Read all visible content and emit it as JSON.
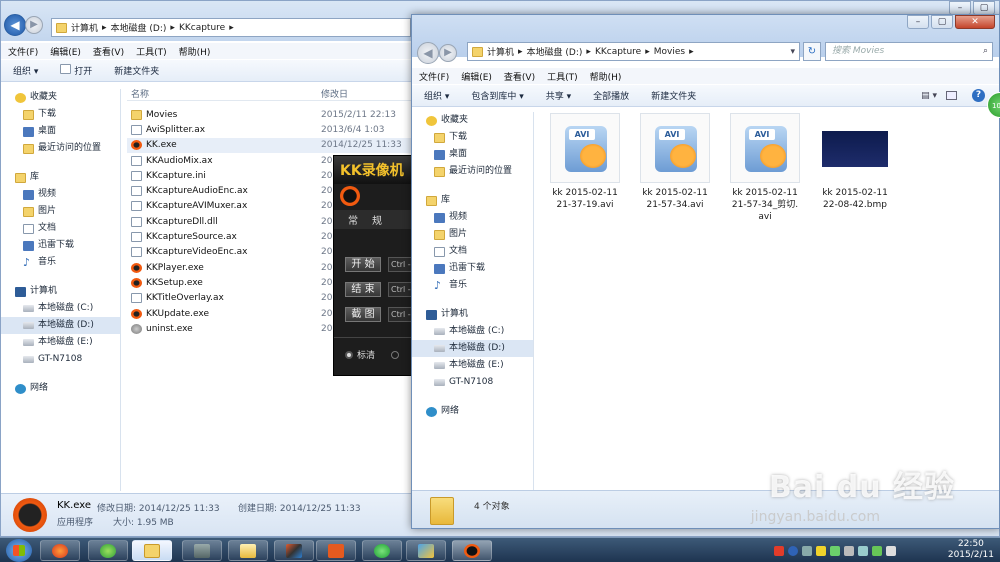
{
  "windowA": {
    "address": [
      "计算机",
      "本地磁盘 (D:)",
      "KKcapture"
    ],
    "menu": [
      "文件(F)",
      "编辑(E)",
      "查看(V)",
      "工具(T)",
      "帮助(H)"
    ],
    "toolbar": {
      "organize": "组织 ▾",
      "open": "打开",
      "new_folder": "新建文件夹"
    },
    "columns": {
      "name": "名称",
      "modified": "修改日"
    },
    "nav": {
      "favorites": "收藏夹",
      "fav_items": [
        "下载",
        "桌面",
        "最近访问的位置"
      ],
      "libraries": "库",
      "lib_items": [
        "视频",
        "图片",
        "文档",
        "迅雷下载",
        "音乐"
      ],
      "computer": "计算机",
      "drives": [
        "本地磁盘 (C:)",
        "本地磁盘 (D:)",
        "本地磁盘 (E:)",
        "GT-N7108"
      ],
      "network": "网络"
    },
    "files": [
      {
        "name": "Movies",
        "date": "2015/2/11 22:13",
        "icon": "folder-icon"
      },
      {
        "name": "AviSplitter.ax",
        "date": "2013/6/4 1:03",
        "icon": "doc-icon"
      },
      {
        "name": "KK.exe",
        "date": "2014/12/25 11:33",
        "icon": "kk-icon"
      },
      {
        "name": "KKAudioMix.ax",
        "date": "201",
        "icon": "doc-icon"
      },
      {
        "name": "KKcapture.ini",
        "date": "201",
        "icon": "doc-icon"
      },
      {
        "name": "KKcaptureAudioEnc.ax",
        "date": "201",
        "icon": "doc-icon"
      },
      {
        "name": "KKcaptureAVIMuxer.ax",
        "date": "201",
        "icon": "doc-icon"
      },
      {
        "name": "KKcaptureDll.dll",
        "date": "201",
        "icon": "doc-icon"
      },
      {
        "name": "KKcaptureSource.ax",
        "date": "201",
        "icon": "doc-icon"
      },
      {
        "name": "KKcaptureVideoEnc.ax",
        "date": "201",
        "icon": "doc-icon"
      },
      {
        "name": "KKPlayer.exe",
        "date": "201",
        "icon": "kk-icon"
      },
      {
        "name": "KKSetup.exe",
        "date": "201",
        "icon": "kk-icon"
      },
      {
        "name": "KKTitleOverlay.ax",
        "date": "201",
        "icon": "doc-icon"
      },
      {
        "name": "KKUpdate.exe",
        "date": "201",
        "icon": "kk-icon"
      },
      {
        "name": "uninst.exe",
        "date": "201",
        "icon": "uninst-icon"
      }
    ],
    "details": {
      "name": "KK.exe",
      "modified_label": "修改日期: 2014/12/25 11:33",
      "created_label": "创建日期: 2014/12/25 11:33",
      "type": "应用程序",
      "size": "大小: 1.95 MB"
    }
  },
  "kk_app": {
    "title": "KK录像机",
    "tabs": [
      "常",
      "规"
    ],
    "buttons": [
      "开 始",
      "结 束",
      "截 图"
    ],
    "keys": [
      "Ctrl -",
      "Ctrl -",
      "Ctrl -"
    ],
    "radio": "标清"
  },
  "windowB": {
    "address": [
      "计算机",
      "本地磁盘 (D:)",
      "KKcapture",
      "Movies"
    ],
    "search_placeholder": "搜索 Movies",
    "menu": [
      "文件(F)",
      "编辑(E)",
      "查看(V)",
      "工具(T)",
      "帮助(H)"
    ],
    "toolbar": [
      "组织 ▾",
      "包含到库中 ▾",
      "共享 ▾",
      "全部播放",
      "新建文件夹"
    ],
    "nav": {
      "favorites": "收藏夹",
      "fav_items": [
        "下载",
        "桌面",
        "最近访问的位置"
      ],
      "libraries": "库",
      "lib_items": [
        "视频",
        "图片",
        "文档",
        "迅雷下载",
        "音乐"
      ],
      "computer": "计算机",
      "drives": [
        "本地磁盘 (C:)",
        "本地磁盘 (D:)",
        "本地磁盘 (E:)",
        "GT-N7108"
      ],
      "network": "网络"
    },
    "tiles": [
      {
        "line1": "kk 2015-02-11",
        "line2": "21-37-19.avi",
        "line3": "",
        "type": "avi"
      },
      {
        "line1": "kk 2015-02-11",
        "line2": "21-57-34.avi",
        "line3": "",
        "type": "avi"
      },
      {
        "line1": "kk 2015-02-11",
        "line2": "21-57-34_剪切.",
        "line3": "avi",
        "type": "avi"
      },
      {
        "line1": "kk 2015-02-11",
        "line2": "22-08-42.bmp",
        "line3": "",
        "type": "bmp"
      }
    ],
    "status": "4 个对象"
  },
  "taskbar": {
    "time": "22:50",
    "date": "2015/2/11"
  },
  "watermark": {
    "main": "Bai du 经验",
    "sub": "jingyan.baidu.com"
  },
  "colors": {
    "accent": "#1e58a8",
    "kk_orange": "#f15a10",
    "kk_gold": "#f3c12b"
  }
}
